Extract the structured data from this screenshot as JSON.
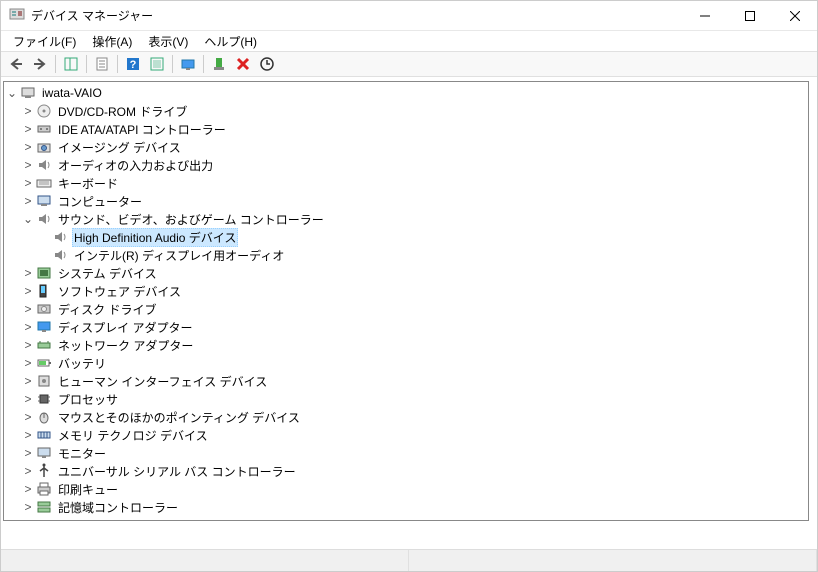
{
  "window": {
    "title": "デバイス マネージャー"
  },
  "menu": {
    "file": "ファイル(F)",
    "action": "操作(A)",
    "view": "表示(V)",
    "help": "ヘルプ(H)"
  },
  "tree": {
    "root": "iwata-VAIO",
    "items": [
      {
        "label": "DVD/CD-ROM ドライブ",
        "icon": "disc"
      },
      {
        "label": "IDE ATA/ATAPI コントローラー",
        "icon": "ide"
      },
      {
        "label": "イメージング デバイス",
        "icon": "camera"
      },
      {
        "label": "オーディオの入力および出力",
        "icon": "speaker"
      },
      {
        "label": "キーボード",
        "icon": "keyboard"
      },
      {
        "label": "コンピューター",
        "icon": "computer"
      }
    ],
    "expanded": {
      "label": "サウンド、ビデオ、およびゲーム コントローラー",
      "children": [
        {
          "label": "High Definition Audio デバイス",
          "selected": true
        },
        {
          "label": "インテル(R) ディスプレイ用オーディオ",
          "selected": false
        }
      ]
    },
    "items2": [
      {
        "label": "システム デバイス",
        "icon": "system"
      },
      {
        "label": "ソフトウェア デバイス",
        "icon": "software"
      },
      {
        "label": "ディスク ドライブ",
        "icon": "disk"
      },
      {
        "label": "ディスプレイ アダプター",
        "icon": "display"
      },
      {
        "label": "ネットワーク アダプター",
        "icon": "network"
      },
      {
        "label": "バッテリ",
        "icon": "battery"
      },
      {
        "label": "ヒューマン インターフェイス デバイス",
        "icon": "hid"
      },
      {
        "label": "プロセッサ",
        "icon": "cpu"
      },
      {
        "label": "マウスとそのほかのポインティング デバイス",
        "icon": "mouse"
      },
      {
        "label": "メモリ テクノロジ デバイス",
        "icon": "memory"
      },
      {
        "label": "モニター",
        "icon": "monitor"
      },
      {
        "label": "ユニバーサル シリアル バス コントローラー",
        "icon": "usb"
      },
      {
        "label": "印刷キュー",
        "icon": "printer"
      },
      {
        "label": "記憶域コントローラー",
        "icon": "storage"
      }
    ]
  }
}
